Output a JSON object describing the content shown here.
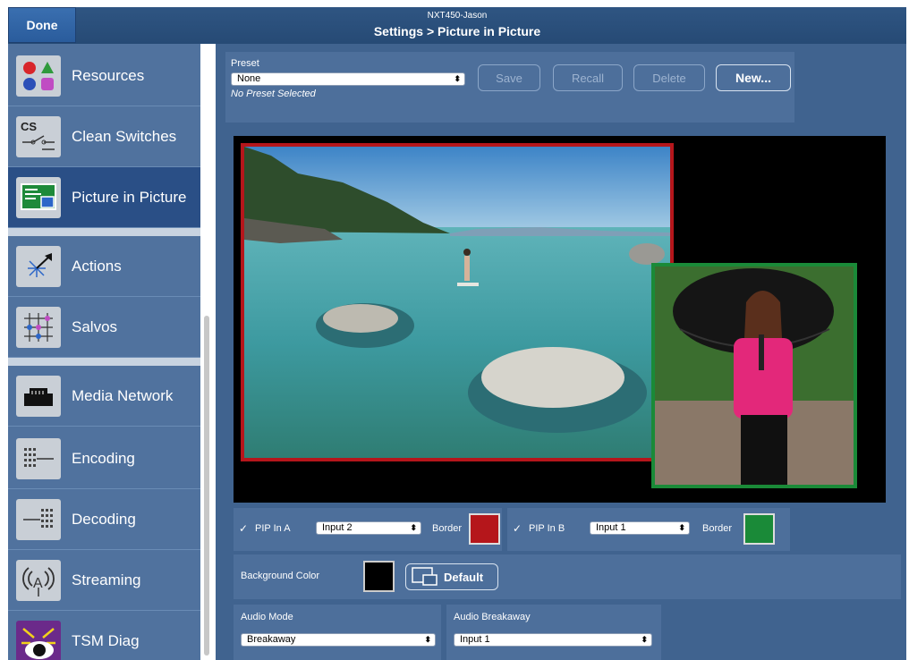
{
  "titlebar": {
    "done_label": "Done",
    "device_name": "NXT450-Jason",
    "breadcrumb": "Settings > Picture in Picture"
  },
  "sidebar": {
    "items": [
      {
        "label": "Resources",
        "icon": "resources-icon"
      },
      {
        "label": "Clean Switches",
        "icon": "clean-switches-icon"
      },
      {
        "label": "Picture in Picture",
        "icon": "picture-in-picture-icon",
        "active": true
      },
      {
        "label": "Actions",
        "icon": "actions-icon"
      },
      {
        "label": "Salvos",
        "icon": "salvos-icon"
      },
      {
        "label": "Media Network",
        "icon": "media-network-icon"
      },
      {
        "label": "Encoding",
        "icon": "encoding-icon"
      },
      {
        "label": "Decoding",
        "icon": "decoding-icon"
      },
      {
        "label": "Streaming",
        "icon": "streaming-icon"
      },
      {
        "label": "TSM Diag",
        "icon": "tsm-diag-icon"
      }
    ]
  },
  "preset": {
    "label": "Preset",
    "selected": "None",
    "status": "No Preset Selected",
    "save_label": "Save",
    "recall_label": "Recall",
    "delete_label": "Delete",
    "new_label": "New..."
  },
  "pip_a": {
    "label": "PIP In A",
    "checked": true,
    "input": "Input 2",
    "border_label": "Border",
    "border_color": "#b5161b"
  },
  "pip_b": {
    "label": "PIP In B",
    "checked": true,
    "input": "Input 1",
    "border_label": "Border",
    "border_color": "#1a8a38"
  },
  "background": {
    "label": "Background Color",
    "color": "#000000",
    "default_label": "Default"
  },
  "audio": {
    "mode_label": "Audio Mode",
    "mode_value": "Breakaway",
    "breakaway_label": "Audio Breakaway",
    "breakaway_value": "Input 1"
  }
}
